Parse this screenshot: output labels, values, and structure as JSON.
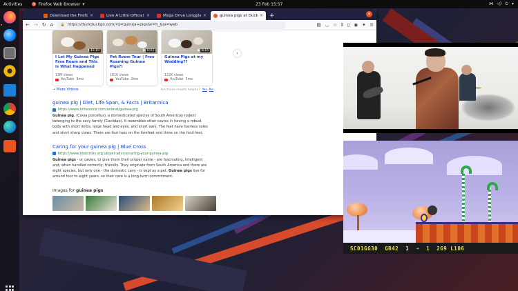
{
  "topbar": {
    "activities": "Activities",
    "app_name": "Firefox Web Browser",
    "clock": "23 Feb  15:57"
  },
  "dock": {
    "icons": [
      "firefox-icon",
      "thunderbird-icon",
      "files-icon",
      "rhythmbox-icon",
      "libreoffice-writer-icon",
      "chrome-icon",
      "edge-dev-icon",
      "software-store-icon"
    ],
    "show_apps": "show-applications-icon"
  },
  "browser": {
    "tabs": [
      {
        "label": "Download the Firefox B",
        "favicon_color": "#e66000"
      },
      {
        "label": "Live A Little Official V",
        "favicon_color": "#e52d27"
      },
      {
        "label": "Mega Drive Longplay",
        "favicon_color": "#e52d27"
      },
      {
        "label": "guinea pigs at DuckDuckG",
        "favicon_color": "#de5833"
      }
    ],
    "new_tab": "+",
    "url": "https://duckduckgo.com/?q=guinea+pigs&t=h_&ia=web",
    "videos": [
      {
        "title": "I Let My Guinea Pigs Free Roam and This is What Happened",
        "views": "13M views",
        "source": "YouTube",
        "age": "9mo",
        "duration": "15:19"
      },
      {
        "title": "Pet Room Tour | Free Roaming Guinea Pigs?!",
        "views": "161K views",
        "source": "YouTube",
        "age": "2mo",
        "duration": "6:03"
      },
      {
        "title": "Guinea Pigs at my Wedding??",
        "views": "122K views",
        "source": "YouTube",
        "age": "5mo",
        "duration": "8:16"
      }
    ],
    "more_videos": "More Videos",
    "feedback": {
      "question": "Are these results helpful?",
      "yes": "Yes",
      "no": "No"
    },
    "results": [
      {
        "title": "guinea pig | Diet, Life Span, & Facts | Britannica",
        "url": "https://www.britannica.com/animal/guinea-pig",
        "favicon_color": "#2f6db5",
        "snippet_bold": "Guinea pig",
        "snippet": ", (Cavia porcellus), a domesticated species of South American rodent belonging to the cavy family (Caviidae). It resembles other cavies in having a robust body with short limbs, large head and eyes, and short ears. The feet have hairless soles and short sharp claws. There are four toes on the forefeet and three on the hind feet."
      },
      {
        "title": "Caring for your guinea pig | Blue Cross",
        "url": "https://www.bluecross.org.uk/pet-advice/caring-your-guinea-pig",
        "favicon_color": "#1d6fd1",
        "snippet_bold": "Guinea pigs",
        "snippet": " - or cavies, to give them their proper name - are fascinating, intelligent and, when handled correctly, friendly. They originate from South America and there are eight species, but only one - the domestic cavy - is kept as a pet.",
        "snippet_bold2": "Guinea pigs",
        "snippet2": " live for around four to eight years, so their care is a long-term commitment."
      }
    ],
    "images_label": "Images for",
    "images_query": "guinea pigs"
  },
  "game": {
    "score": "SC01GG30",
    "hud2": "GB42",
    "lives": "1",
    "arrow": "➜",
    "level": "1",
    "time": "2G9 L106"
  },
  "colors": {
    "accent": "#e95420",
    "link": "#1a44c7",
    "url_green": "#1c8a43"
  }
}
